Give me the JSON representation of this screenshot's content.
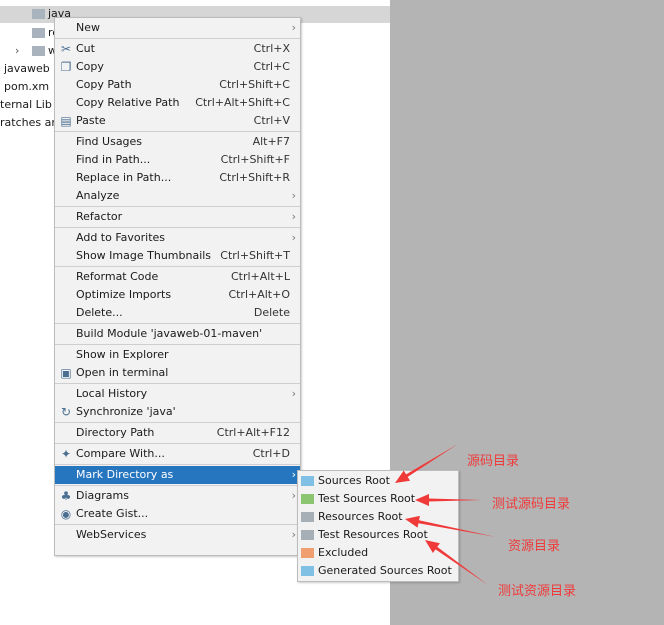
{
  "tree": [
    {
      "label": "main",
      "folder": true
    },
    {
      "label": "java",
      "folder": true
    },
    {
      "label": "re",
      "folder": true
    },
    {
      "label": "w",
      "folder": true,
      "chevron": "›"
    },
    {
      "label": "javaweb"
    },
    {
      "label": "pom.xm"
    },
    {
      "label": "ternal Lib"
    },
    {
      "label": "ratches ar"
    }
  ],
  "menu": [
    {
      "label": "New",
      "submenu": true
    },
    {
      "sep": true
    },
    {
      "label": "Cut",
      "shortcut": "Ctrl+X",
      "icon": "scissors-icon"
    },
    {
      "label": "Copy",
      "shortcut": "Ctrl+C",
      "icon": "copy-icon"
    },
    {
      "label": "Copy Path",
      "shortcut": "Ctrl+Shift+C"
    },
    {
      "label": "Copy Relative Path",
      "shortcut": "Ctrl+Alt+Shift+C"
    },
    {
      "label": "Paste",
      "shortcut": "Ctrl+V",
      "icon": "paste-icon"
    },
    {
      "sep": true
    },
    {
      "label": "Find Usages",
      "shortcut": "Alt+F7"
    },
    {
      "label": "Find in Path...",
      "shortcut": "Ctrl+Shift+F"
    },
    {
      "label": "Replace in Path...",
      "shortcut": "Ctrl+Shift+R"
    },
    {
      "label": "Analyze",
      "submenu": true
    },
    {
      "sep": true
    },
    {
      "label": "Refactor",
      "submenu": true
    },
    {
      "sep": true
    },
    {
      "label": "Add to Favorites",
      "submenu": true
    },
    {
      "label": "Show Image Thumbnails",
      "shortcut": "Ctrl+Shift+T"
    },
    {
      "sep": true
    },
    {
      "label": "Reformat Code",
      "shortcut": "Ctrl+Alt+L"
    },
    {
      "label": "Optimize Imports",
      "shortcut": "Ctrl+Alt+O"
    },
    {
      "label": "Delete...",
      "shortcut": "Delete"
    },
    {
      "sep": true
    },
    {
      "label": "Build Module 'javaweb-01-maven'"
    },
    {
      "sep": true
    },
    {
      "label": "Show in Explorer"
    },
    {
      "label": "Open in terminal",
      "icon": "terminal-icon"
    },
    {
      "sep": true
    },
    {
      "label": "Local History",
      "submenu": true
    },
    {
      "label": "Synchronize 'java'",
      "icon": "sync-icon"
    },
    {
      "sep": true
    },
    {
      "label": "Directory Path",
      "shortcut": "Ctrl+Alt+F12"
    },
    {
      "sep": true
    },
    {
      "label": "Compare With...",
      "shortcut": "Ctrl+D",
      "icon": "compare-icon"
    },
    {
      "sep": true
    },
    {
      "label": "Mark Directory as",
      "submenu": true,
      "selected": true
    },
    {
      "sep": true
    },
    {
      "label": "Diagrams",
      "submenu": true,
      "icon": "diagram-icon"
    },
    {
      "label": "Create Gist...",
      "icon": "github-icon"
    },
    {
      "sep": true
    },
    {
      "label": "WebServices",
      "submenu": true
    }
  ],
  "submenu": [
    {
      "label": "Sources Root",
      "color": "#7fc0e4"
    },
    {
      "label": "Test Sources Root",
      "color": "#8cc570"
    },
    {
      "label": "Resources Root",
      "color": "#a6aeb6"
    },
    {
      "label": "Test Resources Root",
      "color": "#a6aeb6"
    },
    {
      "label": "Excluded",
      "color": "#f0a070"
    },
    {
      "label": "Generated Sources Root",
      "color": "#7fc0e4"
    }
  ],
  "annotations": [
    "源码目录",
    "测试源码目录",
    "资源目录",
    "测试资源目录"
  ],
  "colors": {
    "selection": "#2675bf",
    "annotation": "#f03a3a",
    "background_right": "#b4b4b4"
  }
}
